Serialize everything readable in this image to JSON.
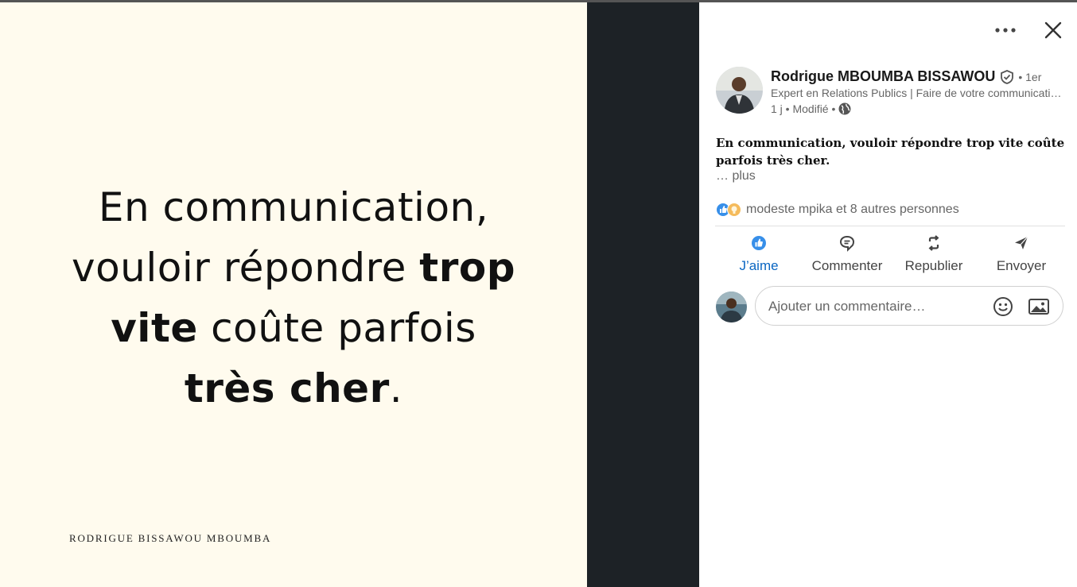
{
  "post_image": {
    "quote_lines": [
      [
        "En communication,",
        ""
      ],
      [
        "vouloir répondre ",
        "trop"
      ],
      [
        "",
        "vite",
        " coûte parfois"
      ],
      [
        "",
        "très cher",
        "."
      ]
    ],
    "line1": "En communication,",
    "line2_a": "vouloir répondre ",
    "line2_b": "trop",
    "line3_a": "vite",
    "line3_b": " coûte parfois",
    "line4_a": "très cher",
    "line4_b": ".",
    "signature": "RODRIGUE BISSAWOU MBOUMBA"
  },
  "author": {
    "name": "Rodrigue MBOUMBA BISSAWOU",
    "degree": "• 1er",
    "headline": "Expert en Relations Publics | Faire de votre communication un levier",
    "meta_time": "1 j • Modifié •",
    "verified_icon": "shield-check-icon",
    "visibility_icon": "globe-icon"
  },
  "post": {
    "text": "En communication, vouloir répondre trop vite coûte parfois très cher.",
    "see_more": "… plus"
  },
  "reactions": {
    "summary": "modeste mpika et 8 autres personnes",
    "icons": [
      "like-icon",
      "insightful-icon"
    ]
  },
  "actions": [
    {
      "label": "J’aime",
      "icon": "like-icon",
      "active": true
    },
    {
      "label": "Commenter",
      "icon": "comment-icon",
      "active": false
    },
    {
      "label": "Republier",
      "icon": "repost-icon",
      "active": false
    },
    {
      "label": "Envoyer",
      "icon": "send-icon",
      "active": false
    }
  ],
  "comment": {
    "placeholder": "Ajouter un commentaire…",
    "value": ""
  },
  "colors": {
    "image_bg": "#fffbee",
    "dark_gap": "#1d2226",
    "accent": "#0a66c2",
    "muted_text": "#666666"
  }
}
